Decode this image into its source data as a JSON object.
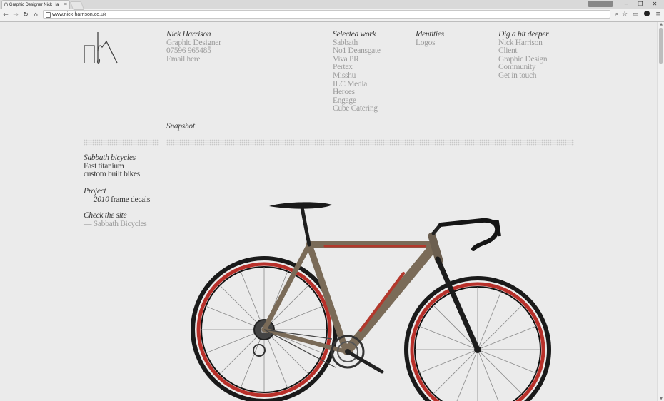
{
  "browser": {
    "tab_title": "Graphic Designer Nick Ha",
    "profile_badge": "",
    "url": "www.nick-harrison.co.uk",
    "icons": {
      "back": "back-arrow-icon",
      "forward": "forward-arrow-icon",
      "reload": "reload-icon",
      "home": "home-icon",
      "zoom": "zoom-icon",
      "star": "bookmark-star-icon",
      "cast": "cast-icon",
      "extension": "extension-icon",
      "menu": "menu-icon"
    }
  },
  "site": {
    "contact": {
      "name": "Nick Harrison",
      "role": "Graphic Designer",
      "phone": "07596 965485",
      "email": "Email here"
    },
    "selected_work": {
      "heading": "Selected work",
      "items": [
        "Sabbath",
        "No1 Deansgate",
        "Viva PR",
        "Pertex",
        "Misshu",
        "ILC Media",
        "Heroes",
        "Engage",
        "Cube Catering"
      ]
    },
    "identities": {
      "heading": "Identities",
      "items": [
        "Logos"
      ]
    },
    "dig_deeper": {
      "heading": "Dig a bit deeper",
      "items": [
        "Nick Harrison",
        "Client",
        "Graphic Design",
        "Community",
        "Get in touch"
      ]
    },
    "snapshot_label": "Snapshot",
    "project_info": {
      "client_heading": "Sabbath bicycles",
      "client_desc_1": "Fast titanium",
      "client_desc_2": "custom built bikes",
      "project_heading": "Project",
      "project_dash": "—",
      "project_year": "2010",
      "project_desc": "frame decals",
      "site_heading": "Check the site",
      "site_dash": "—",
      "site_link": "Sabbath Bicycles"
    },
    "colors": {
      "background": "#ebebeb",
      "heading_text": "#3a3a3a",
      "muted_text": "#9b9b9b"
    }
  }
}
